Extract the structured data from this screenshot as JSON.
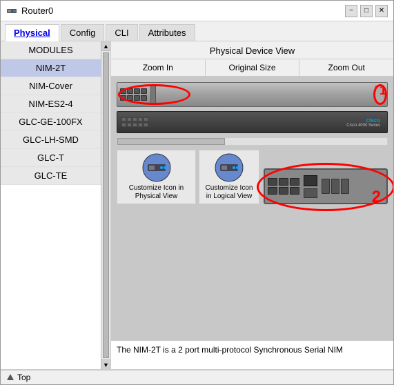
{
  "window": {
    "title": "Router0",
    "minimize_label": "−",
    "maximize_label": "□",
    "close_label": "✕"
  },
  "tabs": [
    {
      "label": "Physical",
      "active": true
    },
    {
      "label": "Config",
      "active": false
    },
    {
      "label": "CLI",
      "active": false
    },
    {
      "label": "Attributes",
      "active": false
    }
  ],
  "sidebar": {
    "items": [
      {
        "label": "MODULES"
      },
      {
        "label": "NIM-2T"
      },
      {
        "label": "NIM-Cover"
      },
      {
        "label": "NIM-ES2-4"
      },
      {
        "label": "GLC-GE-100FX"
      },
      {
        "label": "GLC-LH-SMD"
      },
      {
        "label": "GLC-T"
      },
      {
        "label": "GLC-TE"
      }
    ]
  },
  "device_view": {
    "title": "Physical Device View",
    "zoom_in": "Zoom In",
    "original_size": "Original Size",
    "zoom_out": "Zoom Out"
  },
  "buttons": {
    "customize_physical": "Customize Icon in Physical View",
    "customize_logical": "Customize Icon in Logical View"
  },
  "description": {
    "text": "The NIM-2T is a 2 port multi-protocol Synchronous Serial NIM"
  },
  "status_bar": {
    "label": "Top"
  },
  "annotations": {
    "num1": "1",
    "num2": "2"
  }
}
